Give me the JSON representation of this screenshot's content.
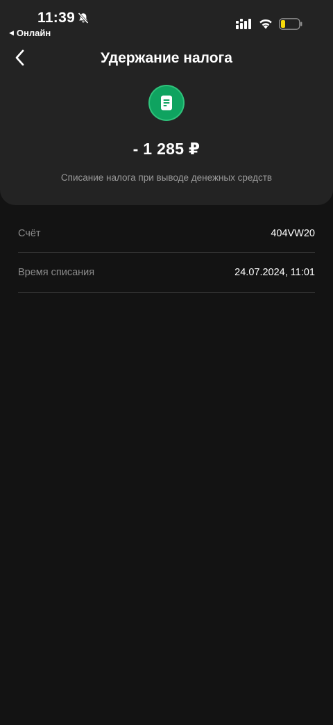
{
  "status_bar": {
    "time": "11:39",
    "back_app_label": "Онлайн"
  },
  "header": {
    "title": "Удержание налога"
  },
  "transaction": {
    "icon": "document-icon",
    "amount": "- 1 285 ₽",
    "description": "Списание налога при выводе денежных средств"
  },
  "details": {
    "account_label": "Счёт",
    "account_value": "404VW20",
    "time_label": "Время списания",
    "time_value": "24.07.2024, 11:01"
  },
  "colors": {
    "background": "#131313",
    "card": "#232323",
    "accent_green": "#0fa360",
    "battery_low": "#f5d90a"
  }
}
